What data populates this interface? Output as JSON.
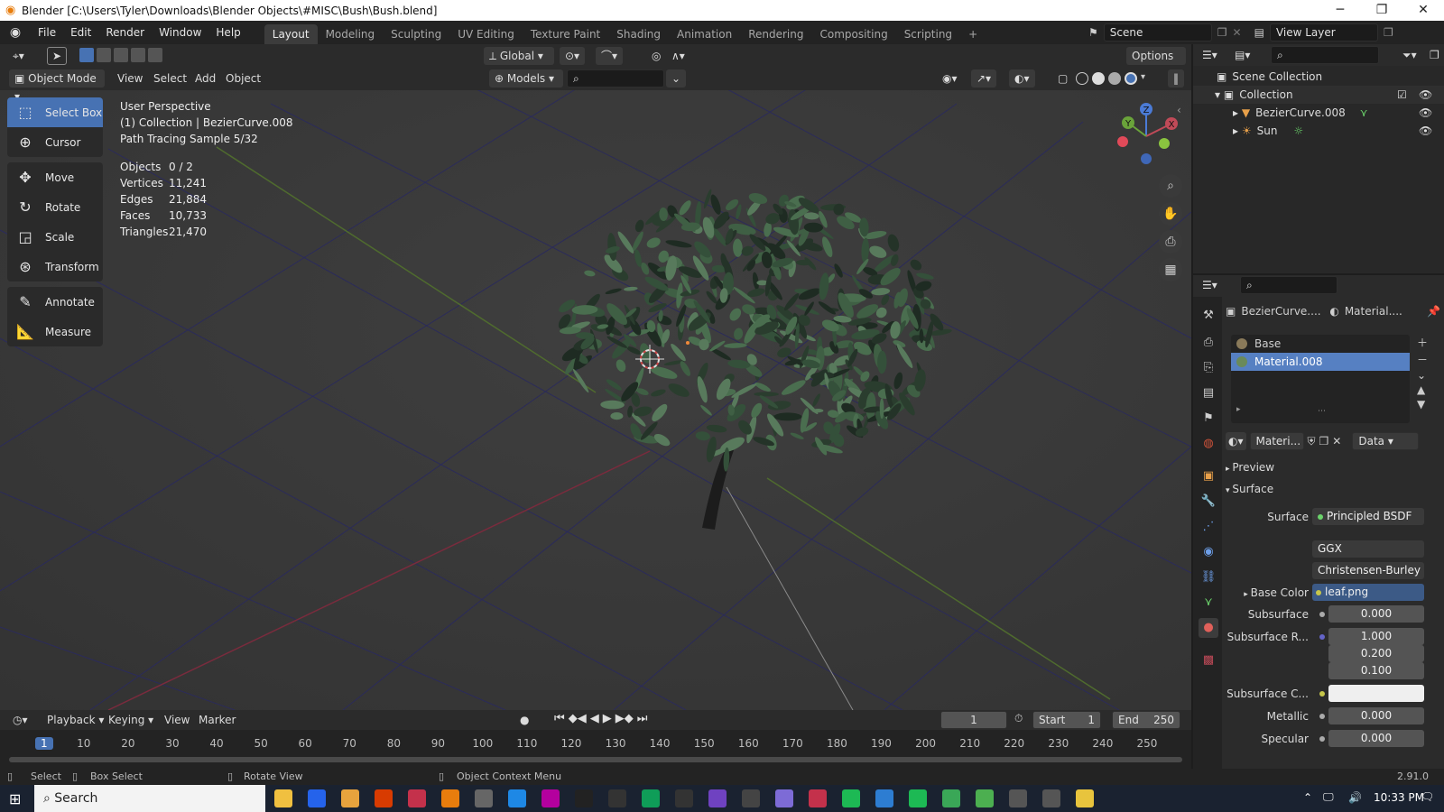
{
  "window": {
    "title": "Blender [C:\\Users\\Tyler\\Downloads\\Blender Objects\\#MISC\\Bush\\Bush.blend]",
    "minimize": "─",
    "maximize": "❐",
    "close": "✕"
  },
  "menubar": {
    "menus": [
      "File",
      "Edit",
      "Render",
      "Window",
      "Help"
    ],
    "workspaces": [
      "Layout",
      "Modeling",
      "Sculpting",
      "UV Editing",
      "Texture Paint",
      "Shading",
      "Animation",
      "Rendering",
      "Compositing",
      "Scripting"
    ],
    "add_tab": "+",
    "scene": "Scene",
    "view_layer": "View Layer"
  },
  "header1": {
    "orientation": "Global",
    "options": "Options"
  },
  "header2": {
    "mode": "Object Mode",
    "menus": [
      "View",
      "Select",
      "Add",
      "Object"
    ],
    "models": "Models"
  },
  "viewport": {
    "perspective": "User Perspective",
    "collection": "(1) Collection | BezierCurve.008",
    "sample": "Path Tracing Sample 5/32",
    "stats": [
      {
        "k": "Objects",
        "v": "0 / 2"
      },
      {
        "k": "Vertices",
        "v": "11,241"
      },
      {
        "k": "Edges",
        "v": "21,884"
      },
      {
        "k": "Faces",
        "v": "10,733"
      },
      {
        "k": "Triangles",
        "v": "21,470"
      }
    ],
    "axes": {
      "x": "X",
      "y": "Y",
      "z": "Z"
    }
  },
  "tools": [
    "Select Box",
    "Cursor",
    "Move",
    "Rotate",
    "Scale",
    "Transform",
    "Annotate",
    "Measure"
  ],
  "timeline": {
    "menus": [
      "Playback",
      "Keying",
      "View",
      "Marker"
    ],
    "current_frame": "1",
    "start_label": "Start",
    "start": "1",
    "end_label": "End",
    "end": "250",
    "ticks": [
      "1",
      "10",
      "20",
      "30",
      "40",
      "50",
      "60",
      "70",
      "80",
      "90",
      "100",
      "110",
      "120",
      "130",
      "140",
      "150",
      "160",
      "170",
      "180",
      "190",
      "200",
      "210",
      "220",
      "230",
      "240",
      "250"
    ]
  },
  "statusbar": {
    "select": "Select",
    "box_select": "Box Select",
    "rotate": "Rotate View",
    "context": "Object Context Menu",
    "version": "2.91.0"
  },
  "taskbar": {
    "search": "Search",
    "time": "10:33 PM"
  },
  "outliner": {
    "root": "Scene Collection",
    "collection": "Collection",
    "items": [
      "BezierCurve.008",
      "Sun"
    ]
  },
  "properties": {
    "object": "BezierCurve....",
    "material": "Material....",
    "slots": [
      "Base",
      "Material.008"
    ],
    "mat_name": "Materi...",
    "link": "Data",
    "preview": "Preview",
    "surface_section": "Surface",
    "surface_label": "Surface",
    "surface_value": "Principled BSDF",
    "distribution": "GGX",
    "sss_method": "Christensen-Burley",
    "rows": [
      {
        "label": "Base Color",
        "value": "leaf.png"
      },
      {
        "label": "Subsurface",
        "value": "0.000"
      },
      {
        "label": "Subsurface R...",
        "value": "1.000"
      },
      {
        "label": "",
        "value": "0.200"
      },
      {
        "label": "",
        "value": "0.100"
      },
      {
        "label": "Subsurface C...",
        "value": ""
      },
      {
        "label": "Metallic",
        "value": "0.000"
      },
      {
        "label": "Specular",
        "value": "0.000"
      }
    ]
  }
}
